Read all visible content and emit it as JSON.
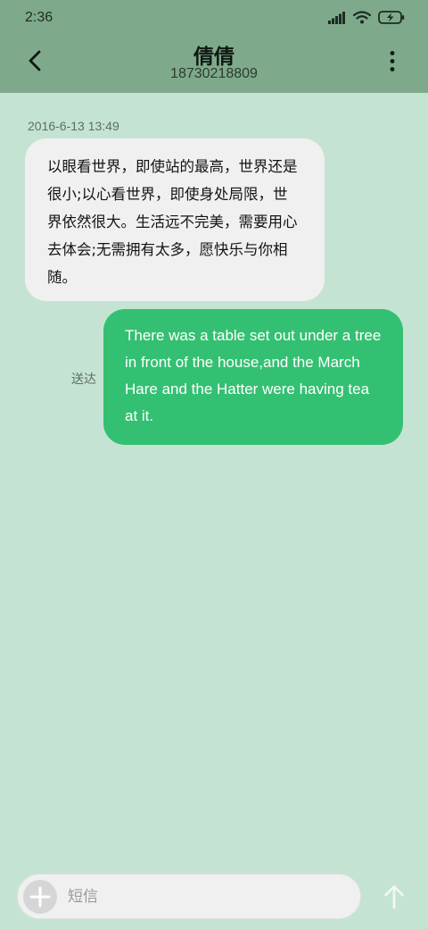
{
  "status_bar": {
    "time": "2:36",
    "icons": [
      "signal-icon",
      "wifi-icon",
      "battery-charging-icon"
    ]
  },
  "header": {
    "contact_name": "倩倩",
    "contact_number": "18730218809",
    "back_icon": "chevron-left-icon",
    "menu_icon": "more-vertical-icon"
  },
  "conversation": {
    "timestamp": "2016-6-13 13:49",
    "messages": [
      {
        "direction": "incoming",
        "text": "以眼看世界，即使站的最高，世界还是很小;以心看世界，即使身处局限，世界依然很大。生活远不完美，需要用心去体会;无需拥有太多，愿快乐与你相随。"
      },
      {
        "direction": "outgoing",
        "text": "There was a table set out under a tree in front of the house,and the March Hare and the Hatter were having tea at it.",
        "status": "送达"
      }
    ]
  },
  "composer": {
    "placeholder": "短信",
    "add_icon": "plus-icon",
    "send_icon": "arrow-up-icon"
  },
  "colors": {
    "header_bg": "#7eaa8b",
    "chat_bg": "#c5e3d3",
    "incoming_bubble": "#f0f0f0",
    "outgoing_bubble": "#34c072"
  }
}
